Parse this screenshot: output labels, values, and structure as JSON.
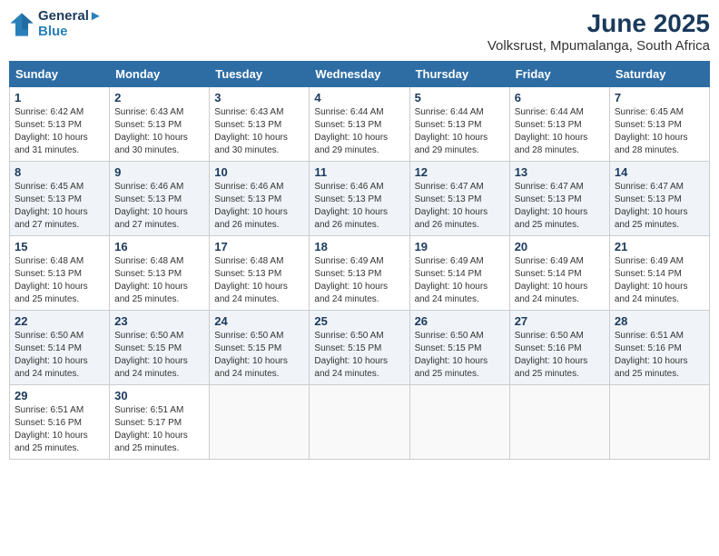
{
  "logo": {
    "line1": "General",
    "line2": "Blue"
  },
  "title": "June 2025",
  "location": "Volksrust, Mpumalanga, South Africa",
  "weekdays": [
    "Sunday",
    "Monday",
    "Tuesday",
    "Wednesday",
    "Thursday",
    "Friday",
    "Saturday"
  ],
  "weeks": [
    [
      {
        "day": "1",
        "info": "Sunrise: 6:42 AM\nSunset: 5:13 PM\nDaylight: 10 hours\nand 31 minutes."
      },
      {
        "day": "2",
        "info": "Sunrise: 6:43 AM\nSunset: 5:13 PM\nDaylight: 10 hours\nand 30 minutes."
      },
      {
        "day": "3",
        "info": "Sunrise: 6:43 AM\nSunset: 5:13 PM\nDaylight: 10 hours\nand 30 minutes."
      },
      {
        "day": "4",
        "info": "Sunrise: 6:44 AM\nSunset: 5:13 PM\nDaylight: 10 hours\nand 29 minutes."
      },
      {
        "day": "5",
        "info": "Sunrise: 6:44 AM\nSunset: 5:13 PM\nDaylight: 10 hours\nand 29 minutes."
      },
      {
        "day": "6",
        "info": "Sunrise: 6:44 AM\nSunset: 5:13 PM\nDaylight: 10 hours\nand 28 minutes."
      },
      {
        "day": "7",
        "info": "Sunrise: 6:45 AM\nSunset: 5:13 PM\nDaylight: 10 hours\nand 28 minutes."
      }
    ],
    [
      {
        "day": "8",
        "info": "Sunrise: 6:45 AM\nSunset: 5:13 PM\nDaylight: 10 hours\nand 27 minutes."
      },
      {
        "day": "9",
        "info": "Sunrise: 6:46 AM\nSunset: 5:13 PM\nDaylight: 10 hours\nand 27 minutes."
      },
      {
        "day": "10",
        "info": "Sunrise: 6:46 AM\nSunset: 5:13 PM\nDaylight: 10 hours\nand 26 minutes."
      },
      {
        "day": "11",
        "info": "Sunrise: 6:46 AM\nSunset: 5:13 PM\nDaylight: 10 hours\nand 26 minutes."
      },
      {
        "day": "12",
        "info": "Sunrise: 6:47 AM\nSunset: 5:13 PM\nDaylight: 10 hours\nand 26 minutes."
      },
      {
        "day": "13",
        "info": "Sunrise: 6:47 AM\nSunset: 5:13 PM\nDaylight: 10 hours\nand 25 minutes."
      },
      {
        "day": "14",
        "info": "Sunrise: 6:47 AM\nSunset: 5:13 PM\nDaylight: 10 hours\nand 25 minutes."
      }
    ],
    [
      {
        "day": "15",
        "info": "Sunrise: 6:48 AM\nSunset: 5:13 PM\nDaylight: 10 hours\nand 25 minutes."
      },
      {
        "day": "16",
        "info": "Sunrise: 6:48 AM\nSunset: 5:13 PM\nDaylight: 10 hours\nand 25 minutes."
      },
      {
        "day": "17",
        "info": "Sunrise: 6:48 AM\nSunset: 5:13 PM\nDaylight: 10 hours\nand 24 minutes."
      },
      {
        "day": "18",
        "info": "Sunrise: 6:49 AM\nSunset: 5:13 PM\nDaylight: 10 hours\nand 24 minutes."
      },
      {
        "day": "19",
        "info": "Sunrise: 6:49 AM\nSunset: 5:14 PM\nDaylight: 10 hours\nand 24 minutes."
      },
      {
        "day": "20",
        "info": "Sunrise: 6:49 AM\nSunset: 5:14 PM\nDaylight: 10 hours\nand 24 minutes."
      },
      {
        "day": "21",
        "info": "Sunrise: 6:49 AM\nSunset: 5:14 PM\nDaylight: 10 hours\nand 24 minutes."
      }
    ],
    [
      {
        "day": "22",
        "info": "Sunrise: 6:50 AM\nSunset: 5:14 PM\nDaylight: 10 hours\nand 24 minutes."
      },
      {
        "day": "23",
        "info": "Sunrise: 6:50 AM\nSunset: 5:15 PM\nDaylight: 10 hours\nand 24 minutes."
      },
      {
        "day": "24",
        "info": "Sunrise: 6:50 AM\nSunset: 5:15 PM\nDaylight: 10 hours\nand 24 minutes."
      },
      {
        "day": "25",
        "info": "Sunrise: 6:50 AM\nSunset: 5:15 PM\nDaylight: 10 hours\nand 24 minutes."
      },
      {
        "day": "26",
        "info": "Sunrise: 6:50 AM\nSunset: 5:15 PM\nDaylight: 10 hours\nand 25 minutes."
      },
      {
        "day": "27",
        "info": "Sunrise: 6:50 AM\nSunset: 5:16 PM\nDaylight: 10 hours\nand 25 minutes."
      },
      {
        "day": "28",
        "info": "Sunrise: 6:51 AM\nSunset: 5:16 PM\nDaylight: 10 hours\nand 25 minutes."
      }
    ],
    [
      {
        "day": "29",
        "info": "Sunrise: 6:51 AM\nSunset: 5:16 PM\nDaylight: 10 hours\nand 25 minutes."
      },
      {
        "day": "30",
        "info": "Sunrise: 6:51 AM\nSunset: 5:17 PM\nDaylight: 10 hours\nand 25 minutes."
      },
      {
        "day": "",
        "info": ""
      },
      {
        "day": "",
        "info": ""
      },
      {
        "day": "",
        "info": ""
      },
      {
        "day": "",
        "info": ""
      },
      {
        "day": "",
        "info": ""
      }
    ]
  ]
}
